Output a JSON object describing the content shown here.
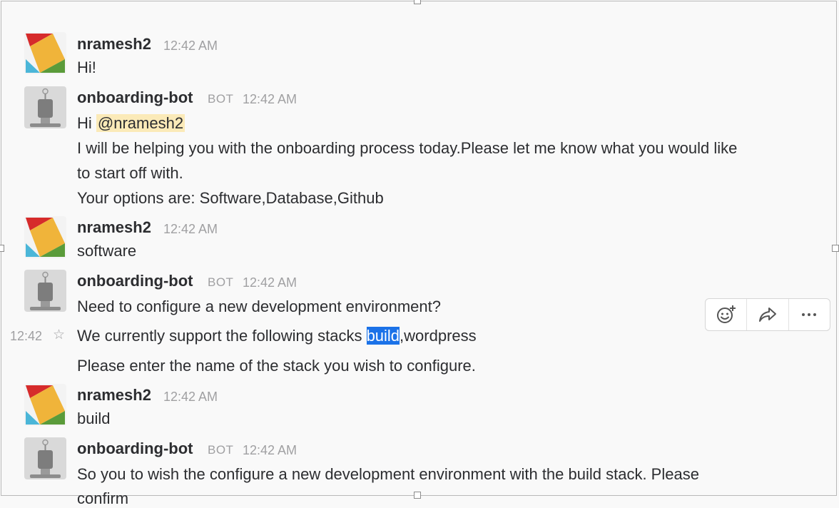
{
  "messages": [
    {
      "author": "nramesh2",
      "time": "12:42 AM",
      "lines": [
        "Hi!"
      ]
    },
    {
      "author": "onboarding-bot",
      "bot_tag": "BOT",
      "time": "12:42 AM",
      "greeting_prefix": "Hi ",
      "mention": "@nramesh2",
      "lines": [
        "I will be helping you with the onboarding process today.Please let me know what you would like",
        "to start off with.",
        "Your options are: Software,Database,Github"
      ]
    },
    {
      "author": "nramesh2",
      "time": "12:42 AM",
      "lines": [
        "software"
      ]
    },
    {
      "author": "onboarding-bot",
      "bot_tag": "BOT",
      "time": "12:42 AM",
      "lines": [
        "Need to configure a new development environment?"
      ],
      "continuation": {
        "hover_time": "12:42",
        "prefix": "We currently support the following stacks ",
        "highlighted": "build",
        "suffix": ",wordpress",
        "line2": "Please enter the name of the stack you wish to configure."
      }
    },
    {
      "author": "nramesh2",
      "time": "12:42 AM",
      "lines": [
        "build"
      ]
    },
    {
      "author": "onboarding-bot",
      "bot_tag": "BOT",
      "time": "12:42 AM",
      "lines": [
        "So you to wish the configure a new development environment with the build stack. Please",
        "confirm"
      ]
    }
  ],
  "hover_actions": {
    "icons": [
      "add-reaction-icon",
      "share-icon",
      "more-actions-icon"
    ]
  },
  "colors": {
    "background": "#f9f9f9",
    "mention_bg": "#fbeab8",
    "selection_bg": "#1b72e8",
    "muted_text": "#a0a0a2"
  }
}
